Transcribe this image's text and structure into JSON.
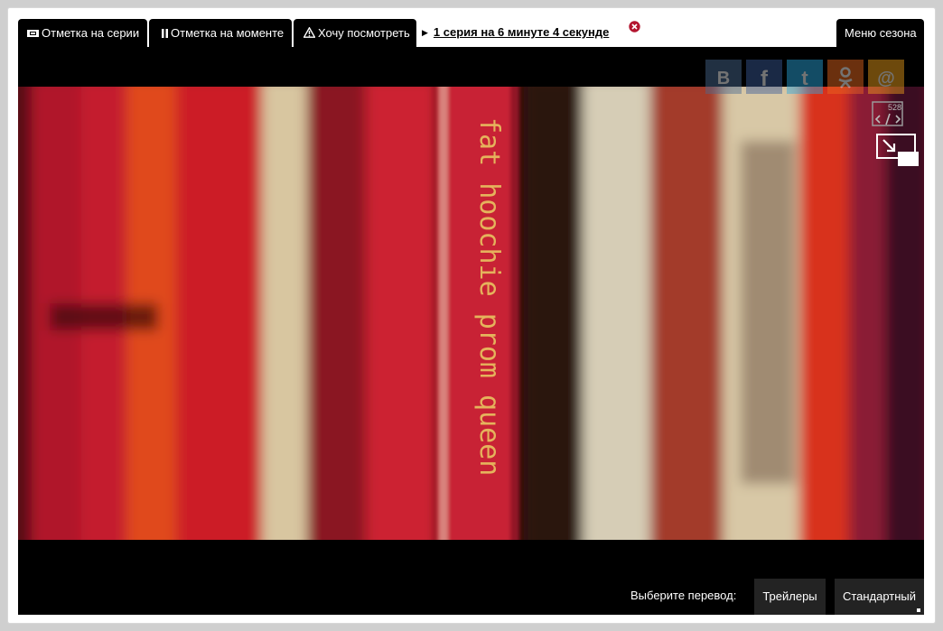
{
  "tabs": {
    "series_label": "Отметка на серии",
    "moment_label": "Отметка на моменте",
    "want_label": "Хочу посмотреть",
    "season_menu_label": "Меню сезона"
  },
  "bookmark": {
    "text": "1 серия на 6 минуте 4 секунде "
  },
  "video": {
    "book_title": "fat hoochie prom queen"
  },
  "share": {
    "items": [
      "vk-icon",
      "facebook-icon",
      "twitter-icon",
      "odnoklassniki-icon",
      "mail-icon"
    ]
  },
  "embed": {
    "size_label": "528"
  },
  "translation": {
    "label": "Выберите перевод:",
    "options": [
      "Трейлеры",
      "Стандартный"
    ]
  },
  "colors": {
    "tab_bg": "#000000",
    "button_bg": "#232323",
    "close_red": "#b3152f"
  }
}
